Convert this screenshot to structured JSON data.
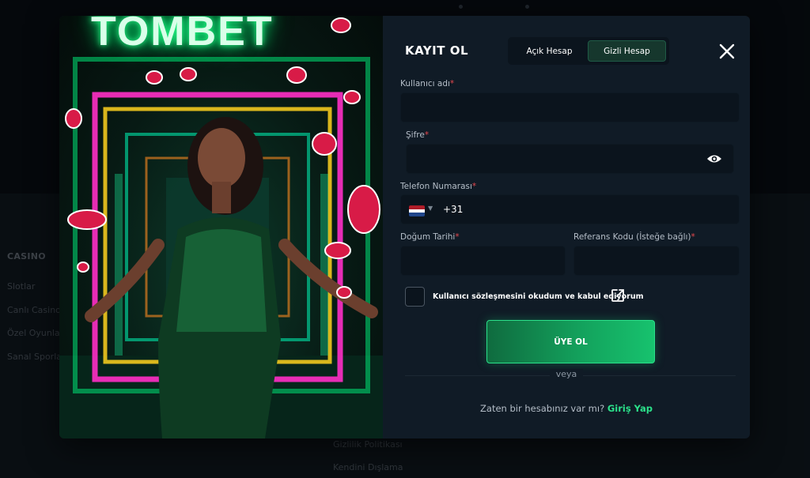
{
  "background": {
    "casino_title": "CASINO",
    "casino_links": [
      "Slotlar",
      "Canlı Casino",
      "Özel Oyunlar",
      "Sanal Sporlar"
    ],
    "legal_links": [
      "Gizlilik Politikası",
      "Kendini Dışlama"
    ]
  },
  "promo": {
    "brand_text": "TOMBET"
  },
  "form": {
    "title": "KAYIT OL",
    "tabs": [
      {
        "label": "Açık Hesap",
        "active": false
      },
      {
        "label": "Gizli Hesap",
        "active": true
      }
    ],
    "fields": {
      "username": {
        "label": "Kullanıcı adı",
        "required": "*",
        "value": ""
      },
      "password": {
        "label": "Şifre",
        "required": "*",
        "value": ""
      },
      "phone": {
        "label": "Telefon Numarası",
        "required": "*",
        "country_code": "+31",
        "flag": "netherlands-flag"
      },
      "birthdate": {
        "label": "Doğum Tarihi",
        "required": "*",
        "value": ""
      },
      "referral": {
        "label": "Referans Kodu (İsteğe bağlı)",
        "required": "*",
        "value": ""
      }
    },
    "agreement_text": "Kullanıcı sözleşmesini okudum ve kabul ediyorum",
    "submit_label": "ÜYE OL",
    "or_text": "veya",
    "login_prompt": "Zaten bir hesabınız var mı?",
    "login_link": "Giriş Yap"
  },
  "colors": {
    "accent": "#17c26e",
    "link": "#2be08a",
    "required": "#e5484d",
    "modal_bg": "#101b26",
    "input_bg": "#0b141d"
  },
  "icons": {
    "close": "close-icon",
    "eye": "eye-icon",
    "external": "external-link-icon"
  }
}
